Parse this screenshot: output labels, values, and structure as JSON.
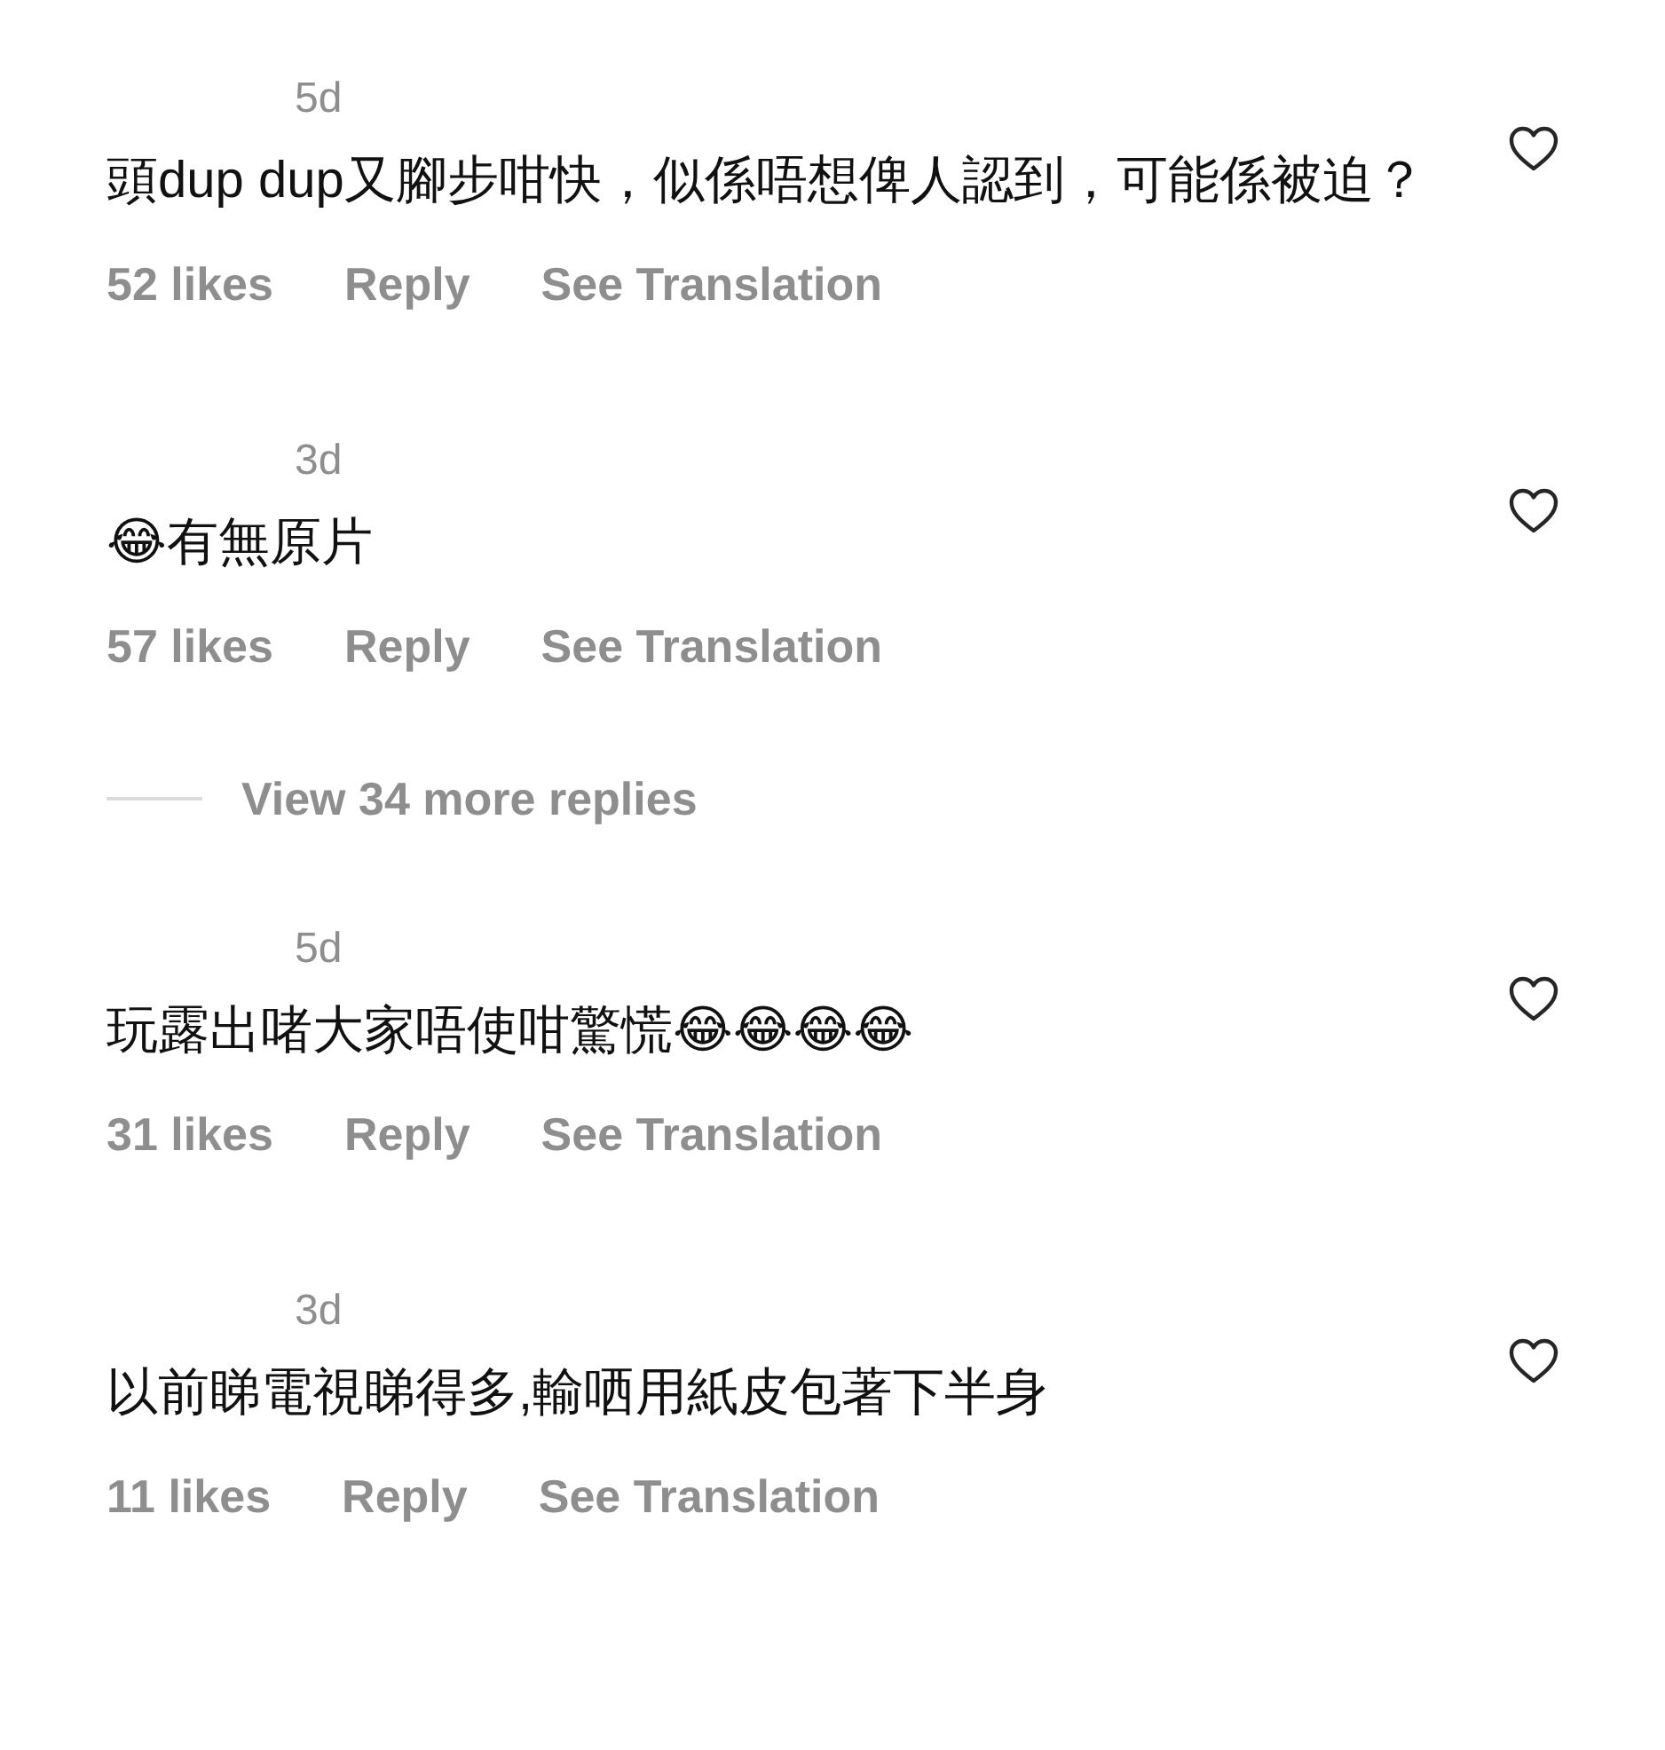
{
  "comments": [
    {
      "kind": "comment",
      "time": "5d",
      "text": "頭dup dup又腳步咁快，似係唔想俾人認到，可能係被迫？",
      "likes": "52 likes",
      "reply": "Reply",
      "translate": "See Translation"
    },
    {
      "kind": "comment",
      "time": "3d",
      "text": "😂有無原片",
      "likes": "57 likes",
      "reply": "Reply",
      "translate": "See Translation"
    },
    {
      "kind": "more",
      "label": "View 34 more replies"
    },
    {
      "kind": "comment",
      "time": "5d",
      "text": "玩露出啫大家唔使咁驚慌😂😂😂😂",
      "likes": "31 likes",
      "reply": "Reply",
      "translate": "See Translation"
    },
    {
      "kind": "comment",
      "time": "3d",
      "text": "以前睇電視睇得多,輸哂用紙皮包著下半身",
      "likes": "11 likes",
      "reply": "Reply",
      "translate": "See Translation"
    }
  ]
}
